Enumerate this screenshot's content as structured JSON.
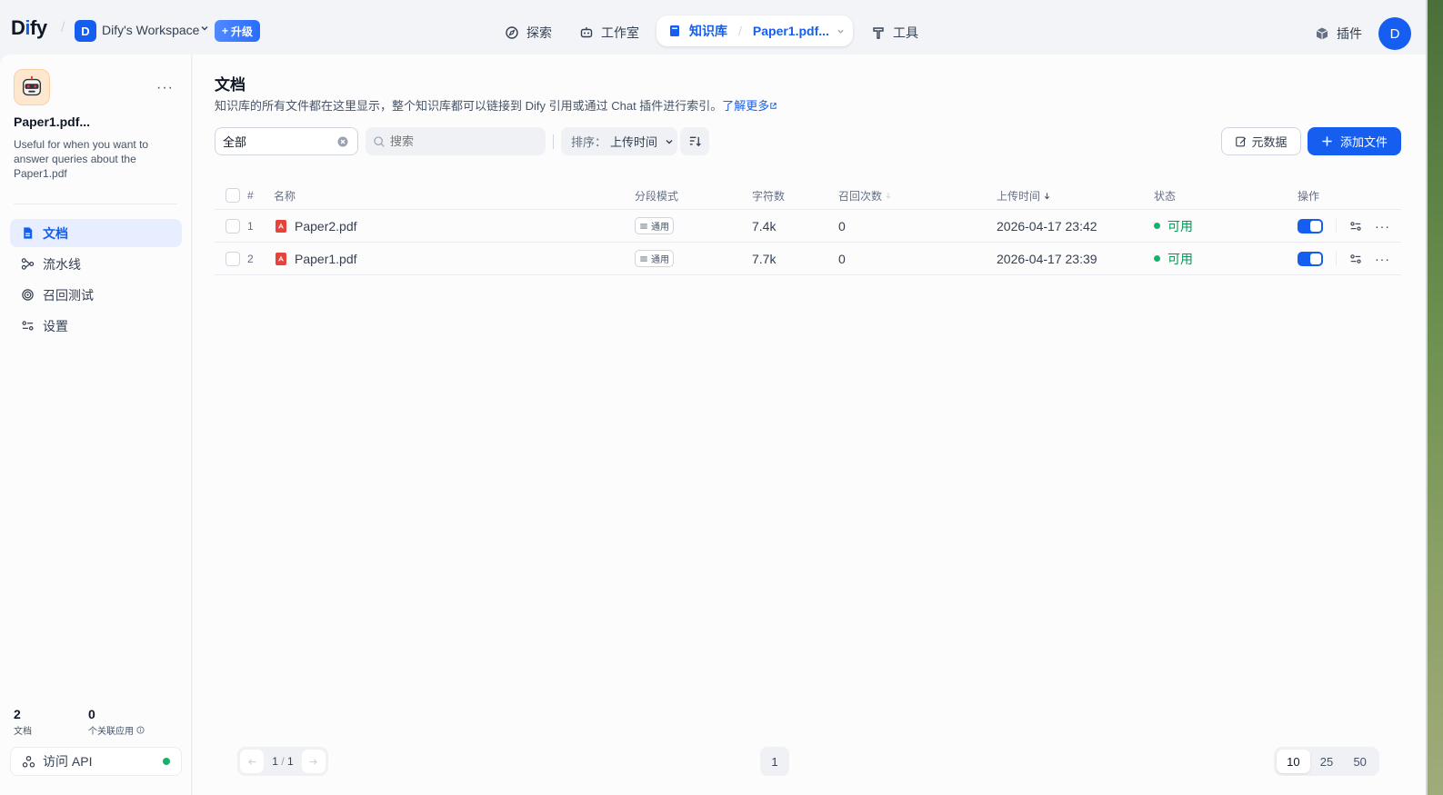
{
  "brand": {
    "logo_prefix": "D",
    "logo_i": "i",
    "logo_suffix": "fy"
  },
  "workspace": {
    "initial": "D",
    "name": "Dify's Workspace",
    "upgrade_label": "升级"
  },
  "nav": {
    "explore": "探索",
    "studio": "工作室",
    "knowledge": "知识库",
    "knowledge_current": "Paper1.pdf...",
    "tools": "工具",
    "plugins": "插件"
  },
  "user": {
    "initial": "D"
  },
  "sidebar": {
    "dataset_title": "Paper1.pdf...",
    "dataset_desc": "Useful for when you want to answer queries about the Paper1.pdf",
    "items": [
      {
        "label": "文档",
        "icon": "document-icon",
        "active": true
      },
      {
        "label": "流水线",
        "icon": "pipeline-icon",
        "active": false
      },
      {
        "label": "召回测试",
        "icon": "target-icon",
        "active": false
      },
      {
        "label": "设置",
        "icon": "settings-icon",
        "active": false
      }
    ],
    "stats": {
      "docs_count": "2",
      "docs_label": "文档",
      "apps_count": "0",
      "apps_label": "个关联应用"
    },
    "api_label": "访问 API"
  },
  "main": {
    "title": "文档",
    "desc": "知识库的所有文件都在这里显示，整个知识库都可以链接到 Dify 引用或通过 Chat 插件进行索引。",
    "learn_more": "了解更多",
    "filter_value": "全部",
    "search_placeholder": "搜索",
    "sort_label": "排序：",
    "sort_value": "上传时间",
    "metadata_label": "元数据",
    "add_file_label": "添加文件"
  },
  "table": {
    "columns": {
      "index": "#",
      "name": "名称",
      "mode": "分段模式",
      "chars": "字符数",
      "hits": "召回次数",
      "uploaded": "上传时间",
      "status": "状态",
      "actions": "操作"
    },
    "rows": [
      {
        "index": "1",
        "name": "Paper2.pdf",
        "mode": "通用",
        "chars": "7.4k",
        "hits": "0",
        "uploaded": "2026-04-17 23:42",
        "status": "可用",
        "enabled": true
      },
      {
        "index": "2",
        "name": "Paper1.pdf",
        "mode": "通用",
        "chars": "7.7k",
        "hits": "0",
        "uploaded": "2026-04-17 23:39",
        "status": "可用",
        "enabled": true
      }
    ]
  },
  "pagination": {
    "current_page": "1",
    "total_pages": "1",
    "page_button": "1",
    "sizes": [
      "10",
      "25",
      "50"
    ],
    "selected_size": "10"
  },
  "colors": {
    "accent": "#155eef",
    "status_ok": "#17b26a",
    "pdf": "#e8433b"
  }
}
